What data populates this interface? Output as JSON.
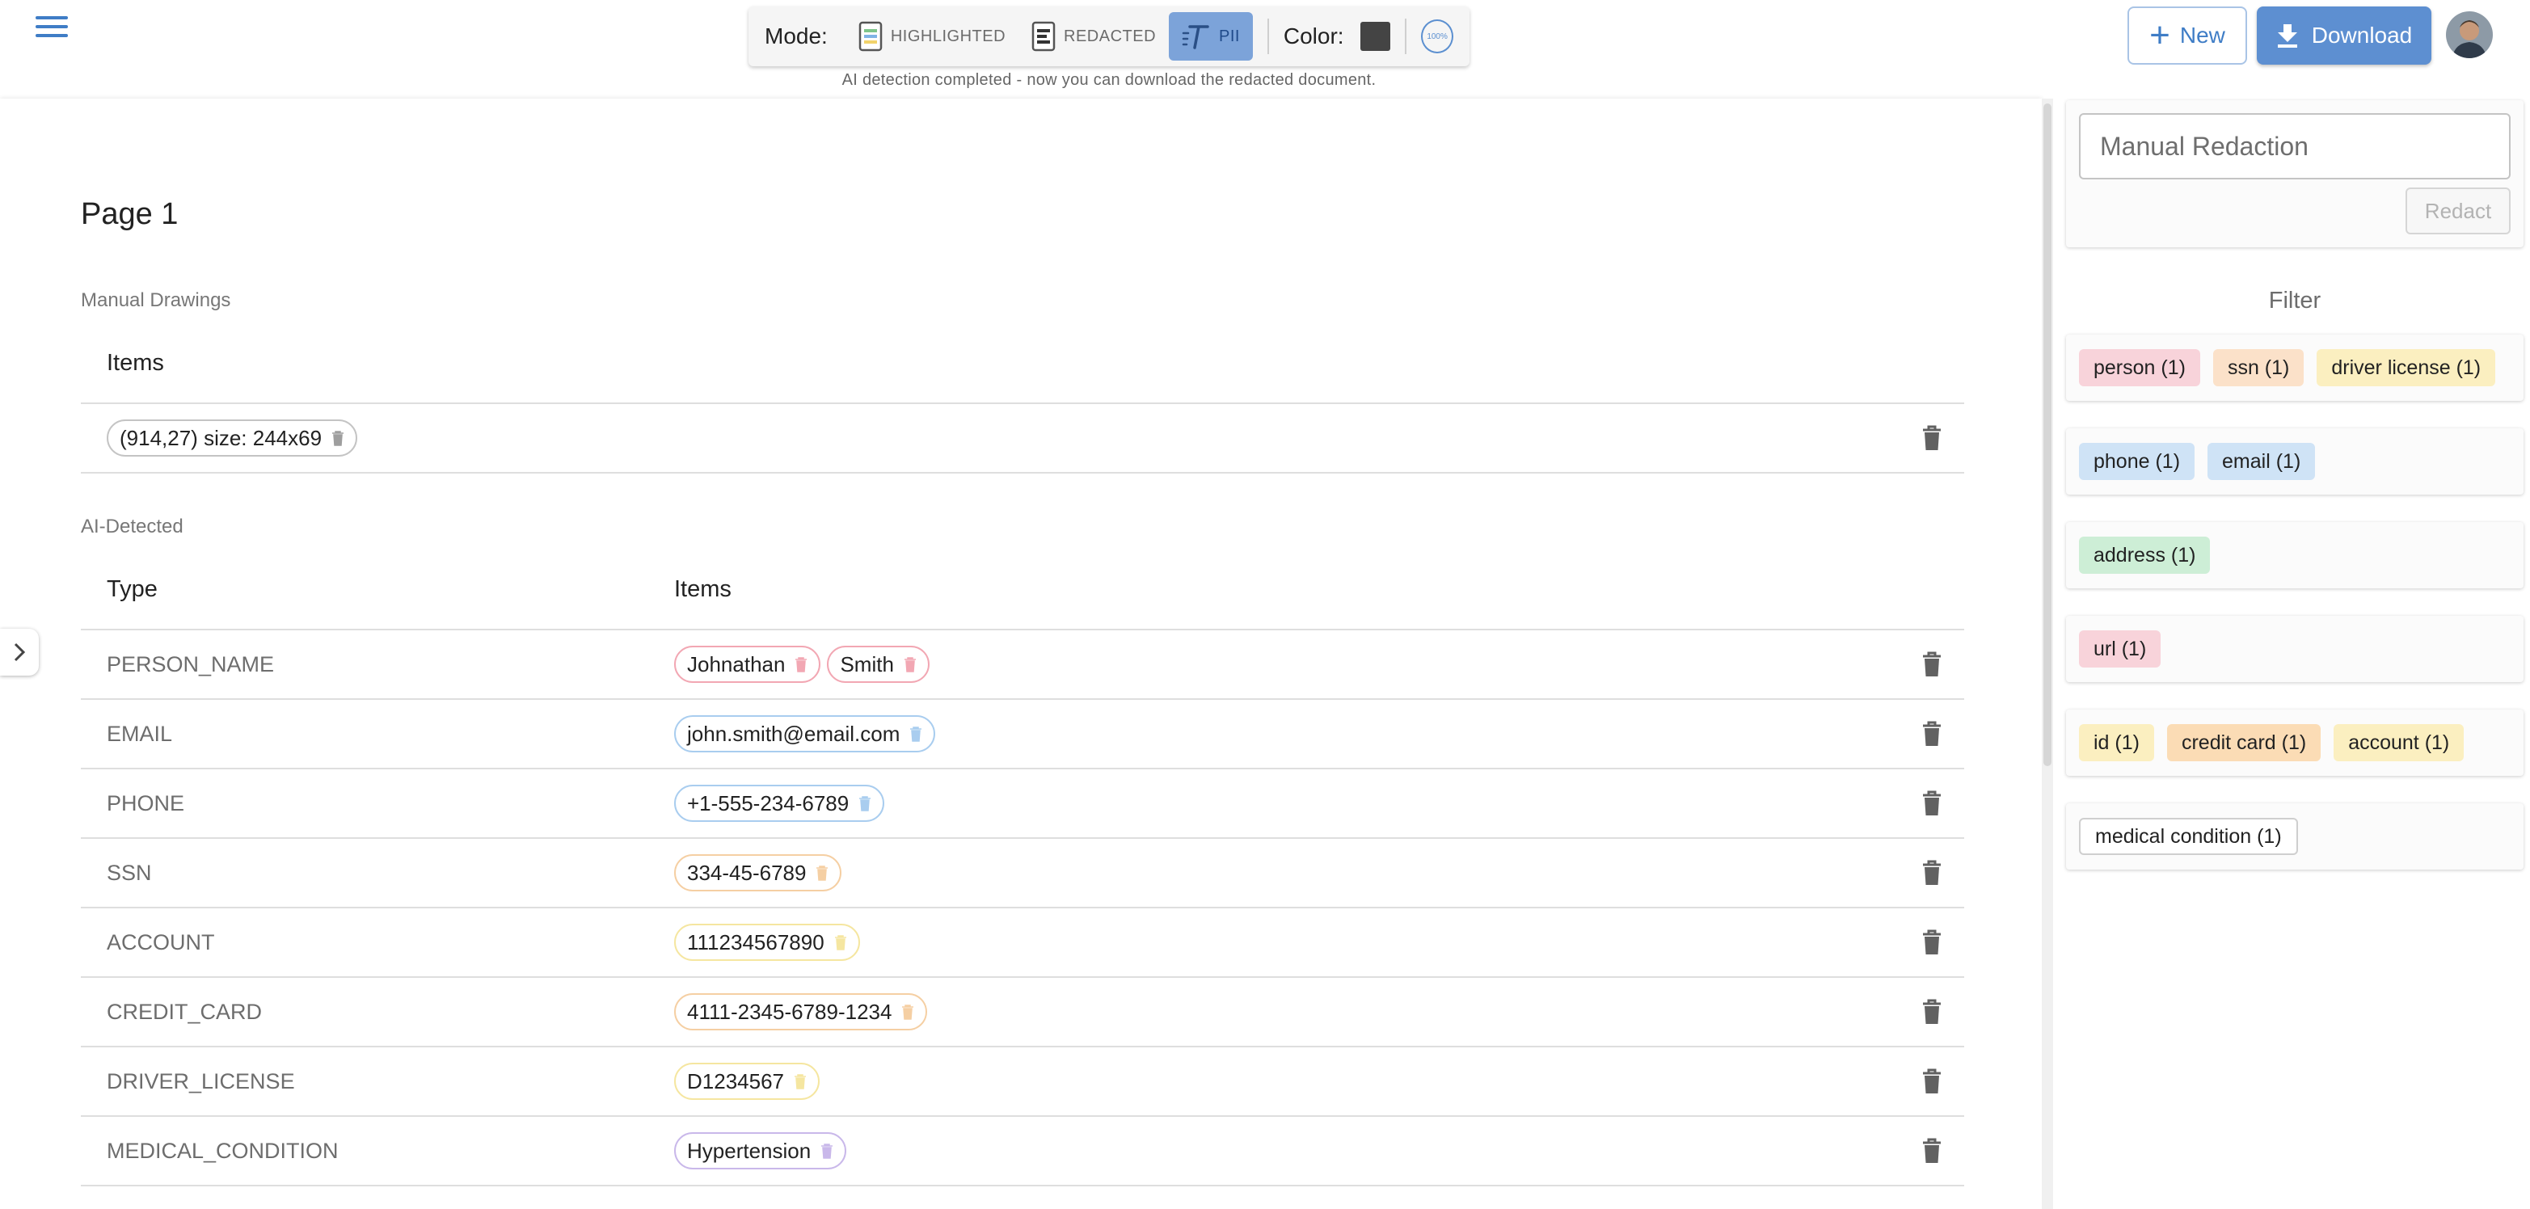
{
  "toolbar": {
    "mode_label": "Mode:",
    "modes": [
      {
        "label": "HIGHLIGHTED",
        "icon": "highlighted-doc-icon",
        "active": false
      },
      {
        "label": "REDACTED",
        "icon": "redacted-doc-icon",
        "active": false
      },
      {
        "label": "PII",
        "icon": "pii-text-icon",
        "active": true
      }
    ],
    "color_label": "Color:",
    "color_value": "#444444",
    "opacity_label": "100%",
    "status_message": "AI detection completed - now you can download the redacted document.",
    "new_label": "New",
    "download_label": "Download"
  },
  "main": {
    "page_title": "Page 1",
    "manual_drawings": {
      "section_label": "Manual Drawings",
      "header_items": "Items",
      "rows": [
        {
          "items": [
            {
              "text": "(914,27) size: 244x69",
              "color": "#9e9e9e"
            }
          ]
        }
      ]
    },
    "ai_detected": {
      "section_label": "AI-Detected",
      "header_type": "Type",
      "header_items": "Items",
      "rows": [
        {
          "type": "PERSON_NAME",
          "items": [
            {
              "text": "Johnathan",
              "color": "#f2a7b3"
            },
            {
              "text": "Smith",
              "color": "#f2a7b3"
            }
          ]
        },
        {
          "type": "EMAIL",
          "items": [
            {
              "text": "john.smith@email.com",
              "color": "#a9cdef"
            }
          ]
        },
        {
          "type": "PHONE",
          "items": [
            {
              "text": "+1-555-234-6789",
              "color": "#a9cdef"
            }
          ]
        },
        {
          "type": "SSN",
          "items": [
            {
              "text": "334-45-6789",
              "color": "#f5cfa3"
            }
          ]
        },
        {
          "type": "ACCOUNT",
          "items": [
            {
              "text": "111234567890",
              "color": "#f5e6a0"
            }
          ]
        },
        {
          "type": "CREDIT_CARD",
          "items": [
            {
              "text": "4111-2345-6789-1234",
              "color": "#f5cfa3"
            }
          ]
        },
        {
          "type": "DRIVER_LICENSE",
          "items": [
            {
              "text": "D1234567",
              "color": "#f5e6a0"
            }
          ]
        },
        {
          "type": "MEDICAL_CONDITION",
          "items": [
            {
              "text": "Hypertension",
              "color": "#c9b8ea"
            }
          ]
        }
      ]
    }
  },
  "right": {
    "manual_redaction_placeholder": "Manual Redaction",
    "redact_label": "Redact",
    "filter_title": "Filter",
    "filter_groups": [
      [
        {
          "label": "person (1)",
          "bg": "#f8d3da"
        },
        {
          "label": "ssn (1)",
          "bg": "#fbe1c9"
        },
        {
          "label": "driver license (1)",
          "bg": "#fbefc0"
        }
      ],
      [
        {
          "label": "phone (1)",
          "bg": "#cfe3f6"
        },
        {
          "label": "email (1)",
          "bg": "#cfe3f6"
        }
      ],
      [
        {
          "label": "address (1)",
          "bg": "#cdeed6"
        }
      ],
      [
        {
          "label": "url (1)",
          "bg": "#f8d3da"
        }
      ],
      [
        {
          "label": "id (1)",
          "bg": "#fbefc0"
        },
        {
          "label": "credit card (1)",
          "bg": "#fbdcb5"
        },
        {
          "label": "account (1)",
          "bg": "#fbefc0"
        }
      ],
      [
        {
          "label": "medical condition (1)",
          "bg": "#ffffff",
          "border": "#cfcfcf"
        }
      ]
    ]
  }
}
